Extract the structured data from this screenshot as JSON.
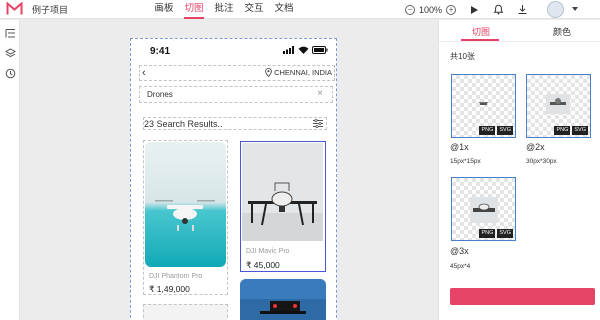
{
  "app": {
    "project_name": "例子项目",
    "brand_color": "#e64367"
  },
  "nav": {
    "items": [
      "画板",
      "切图",
      "批注",
      "交互",
      "文档"
    ],
    "active_index": 1
  },
  "toolbar": {
    "zoom": "100%",
    "zoom_out": "−",
    "zoom_in": "+"
  },
  "phone": {
    "time": "9:41",
    "location": "CHENNAI, INDIA",
    "search_value": "Drones",
    "results_label": "23 Search Results..",
    "products": [
      {
        "name": "DJI Phantom Pro",
        "price": "₹ 1,49,000"
      },
      {
        "name": "DJI Mavic Pro",
        "price": "₹ 45,000"
      }
    ]
  },
  "panel": {
    "tabs": [
      "切图",
      "颜色"
    ],
    "active_tab": 0,
    "count_label": "共10张",
    "assets": [
      {
        "scale": "@1x",
        "size": "15px*15px",
        "formats": [
          "PNG",
          "SVG"
        ]
      },
      {
        "scale": "@2x",
        "size": "30px*30px",
        "formats": [
          "PNG",
          "SVG"
        ]
      },
      {
        "scale": "@3x",
        "size": "45px*4",
        "formats": [
          "PNG",
          "SVG"
        ]
      }
    ]
  }
}
